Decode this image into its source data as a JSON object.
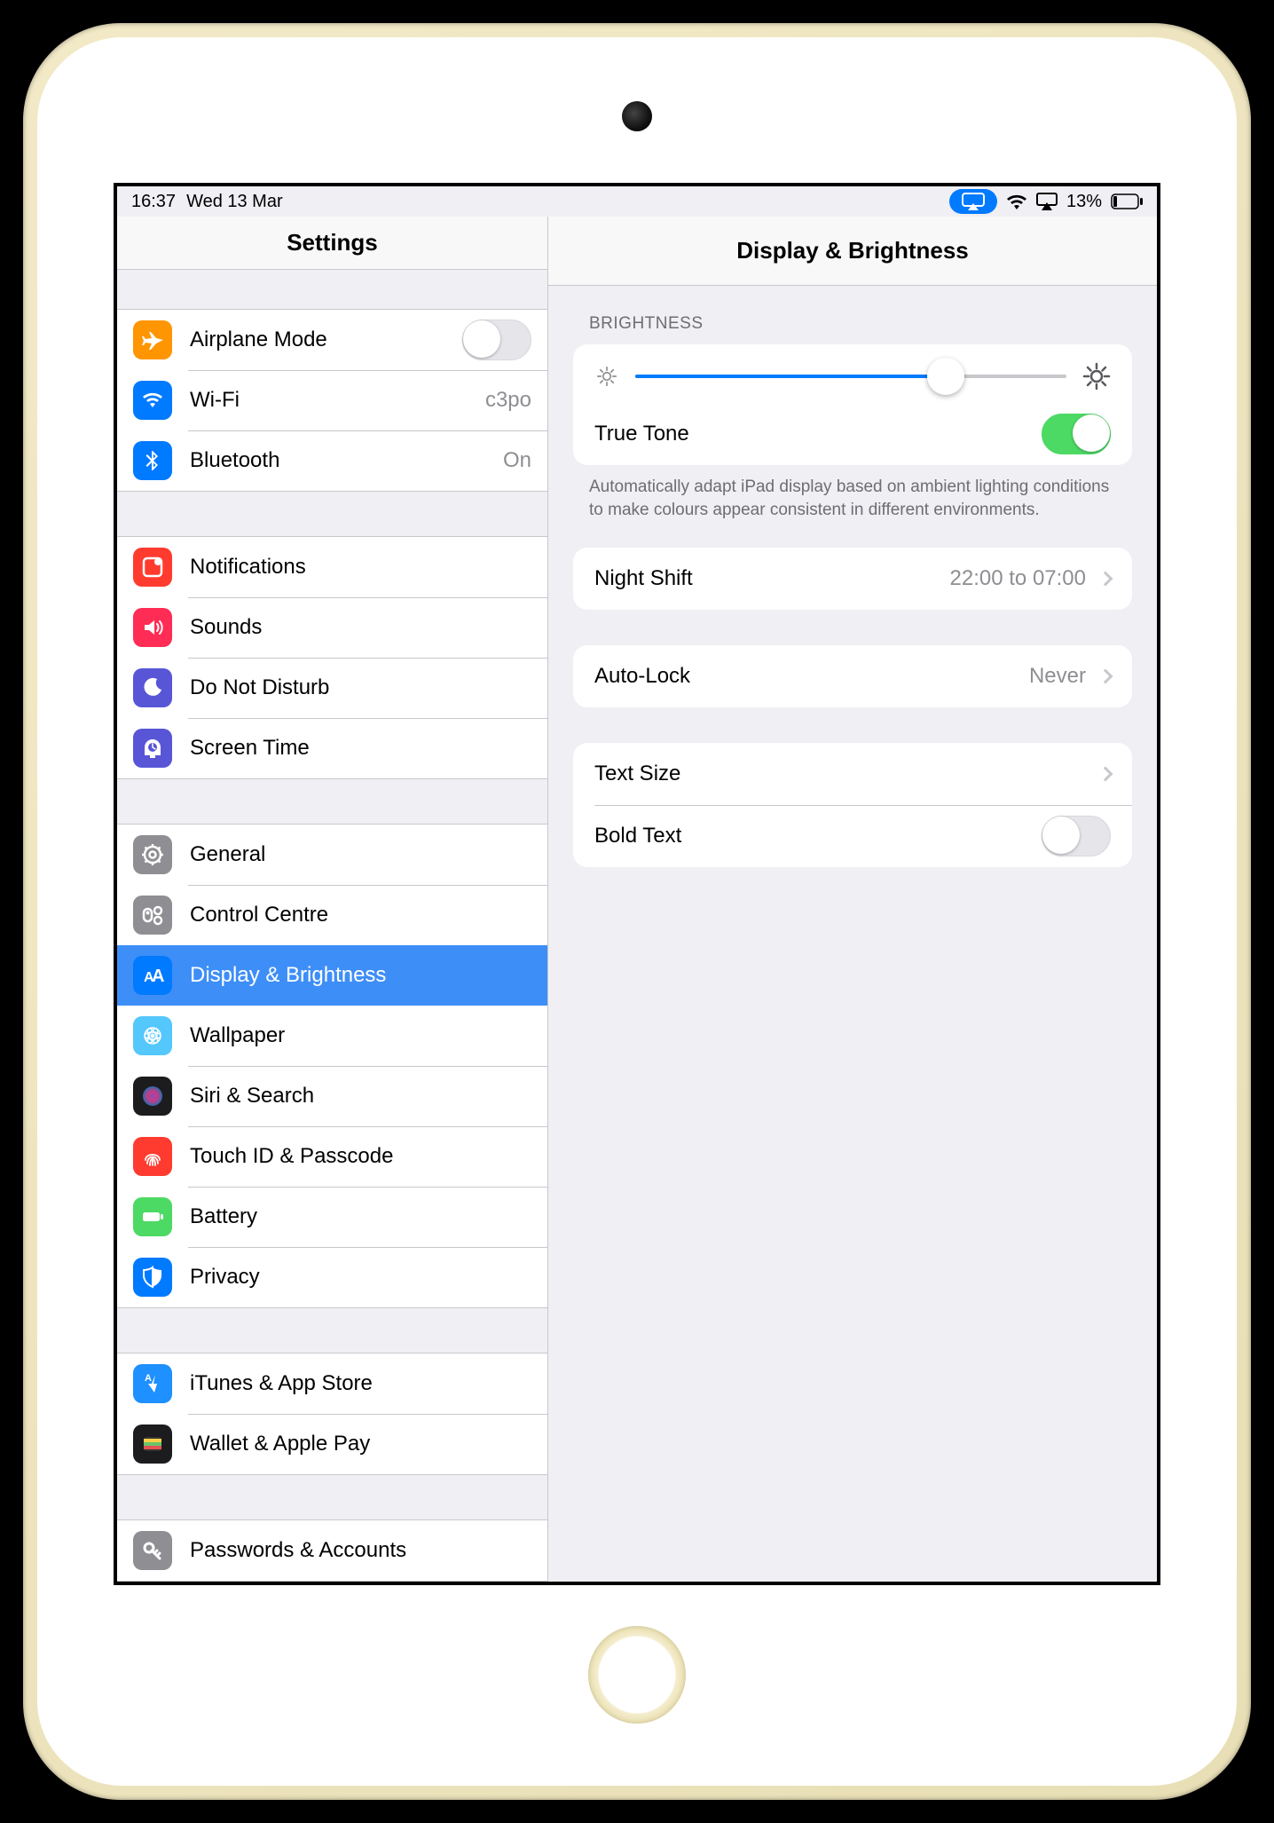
{
  "status_bar": {
    "time": "16:37",
    "date": "Wed 13 Mar",
    "battery_percent": "13%"
  },
  "sidebar": {
    "title": "Settings",
    "groups": [
      {
        "items": [
          {
            "key": "airplane",
            "label": "Airplane Mode",
            "value": "",
            "toggle": false
          },
          {
            "key": "wifi",
            "label": "Wi-Fi",
            "value": "c3po"
          },
          {
            "key": "bluetooth",
            "label": "Bluetooth",
            "value": "On"
          }
        ]
      },
      {
        "items": [
          {
            "key": "notifications",
            "label": "Notifications"
          },
          {
            "key": "sounds",
            "label": "Sounds"
          },
          {
            "key": "dnd",
            "label": "Do Not Disturb"
          },
          {
            "key": "screentime",
            "label": "Screen Time"
          }
        ]
      },
      {
        "items": [
          {
            "key": "general",
            "label": "General"
          },
          {
            "key": "controlcentre",
            "label": "Control Centre"
          },
          {
            "key": "display",
            "label": "Display & Brightness",
            "selected": true
          },
          {
            "key": "wallpaper",
            "label": "Wallpaper"
          },
          {
            "key": "siri",
            "label": "Siri & Search"
          },
          {
            "key": "touchid",
            "label": "Touch ID & Passcode"
          },
          {
            "key": "battery",
            "label": "Battery"
          },
          {
            "key": "privacy",
            "label": "Privacy"
          }
        ]
      },
      {
        "items": [
          {
            "key": "itunes",
            "label": "iTunes & App Store"
          },
          {
            "key": "wallet",
            "label": "Wallet & Apple Pay"
          }
        ]
      },
      {
        "items": [
          {
            "key": "passwords",
            "label": "Passwords & Accounts"
          }
        ]
      }
    ]
  },
  "detail": {
    "title": "Display & Brightness",
    "brightness_header": "BRIGHTNESS",
    "brightness_value_percent": 72,
    "true_tone_label": "True Tone",
    "true_tone_on": true,
    "true_tone_footer": "Automatically adapt iPad display based on ambient lighting conditions to make colours appear consistent in different environments.",
    "night_shift_label": "Night Shift",
    "night_shift_value": "22:00 to 07:00",
    "auto_lock_label": "Auto-Lock",
    "auto_lock_value": "Never",
    "text_size_label": "Text Size",
    "bold_text_label": "Bold Text",
    "bold_text_on": false
  },
  "icon_colors": {
    "airplane": "#ff9500",
    "wifi": "#007aff",
    "bluetooth": "#007aff",
    "notifications": "#ff3b30",
    "sounds": "#ff2d55",
    "dnd": "#5856d6",
    "screentime": "#5856d6",
    "general": "#8e8e93",
    "controlcentre": "#8e8e93",
    "display": "#007aff",
    "wallpaper": "#54c7fc",
    "siri": "#1c1c1e",
    "touchid": "#ff3b30",
    "battery": "#4cd964",
    "privacy": "#007aff",
    "itunes": "#1e90ff",
    "wallet": "#1c1c1e",
    "passwords": "#8e8e93"
  }
}
